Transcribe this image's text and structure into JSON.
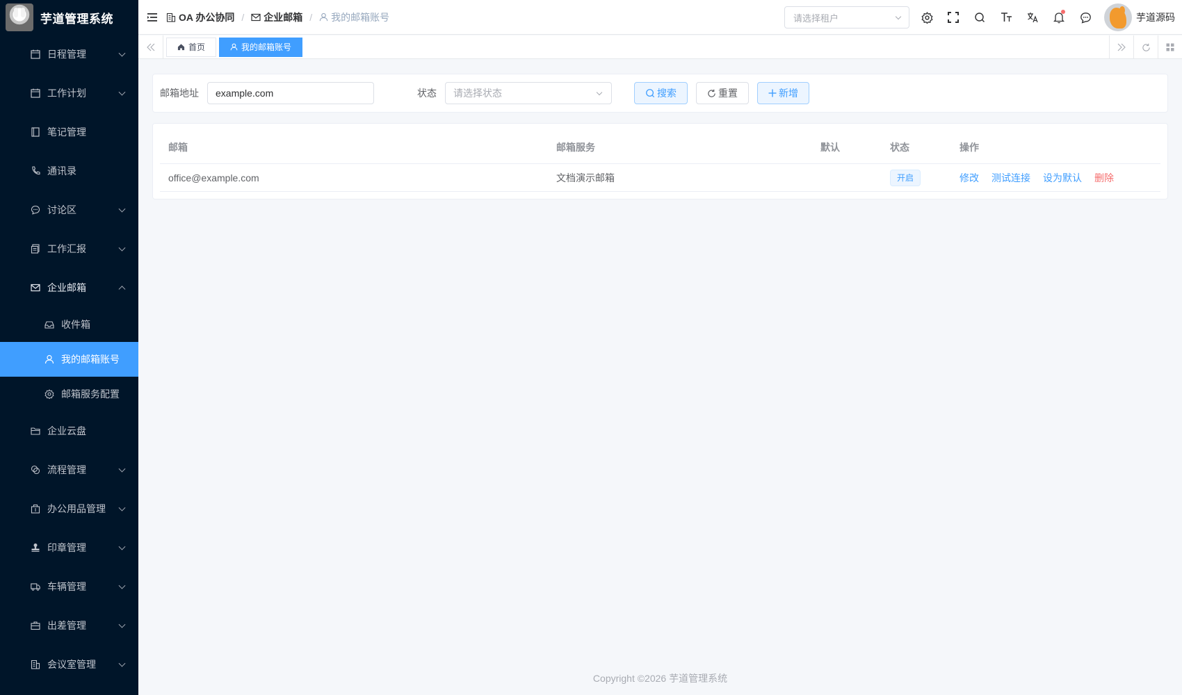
{
  "app": {
    "title": "芋道管理系统"
  },
  "sidebar": {
    "items": [
      {
        "label": "日程管理",
        "icon": "calendar-icon",
        "expandable": true
      },
      {
        "label": "工作计划",
        "icon": "calendar-icon",
        "expandable": true
      },
      {
        "label": "笔记管理",
        "icon": "notebook-icon",
        "expandable": false
      },
      {
        "label": "通讯录",
        "icon": "phone-icon",
        "expandable": false
      },
      {
        "label": "讨论区",
        "icon": "chat-icon",
        "expandable": true
      },
      {
        "label": "工作汇报",
        "icon": "report-icon",
        "expandable": true
      },
      {
        "label": "企业邮箱",
        "icon": "mail-icon",
        "expandable": true,
        "expanded": true
      },
      {
        "label": "收件箱",
        "icon": "inbox-icon",
        "sub": true
      },
      {
        "label": "我的邮箱账号",
        "icon": "user-icon",
        "sub": true,
        "active": true
      },
      {
        "label": "邮箱服务配置",
        "icon": "gear-icon",
        "sub": true
      },
      {
        "label": "企业云盘",
        "icon": "folder-icon",
        "expandable": false
      },
      {
        "label": "流程管理",
        "icon": "flow-icon",
        "expandable": true
      },
      {
        "label": "办公用品管理",
        "icon": "box-icon",
        "expandable": true
      },
      {
        "label": "印章管理",
        "icon": "stamp-icon",
        "expandable": true
      },
      {
        "label": "车辆管理",
        "icon": "truck-icon",
        "expandable": true
      },
      {
        "label": "出差管理",
        "icon": "briefcase-icon",
        "expandable": true
      },
      {
        "label": "会议室管理",
        "icon": "building-icon",
        "expandable": true
      }
    ]
  },
  "header": {
    "breadcrumb": [
      "OA 办公协同",
      "企业邮箱",
      "我的邮箱账号"
    ],
    "tenant_placeholder": "请选择租户",
    "user_name": "芋道源码"
  },
  "tags": {
    "items": [
      {
        "label": "首页",
        "icon": "home-icon",
        "active": false
      },
      {
        "label": "我的邮箱账号",
        "icon": "user-icon",
        "active": true
      }
    ]
  },
  "search": {
    "email_label": "邮箱地址",
    "email_value": "example.com",
    "status_label": "状态",
    "status_placeholder": "请选择状态",
    "search_button": "搜索",
    "reset_button": "重置",
    "add_button": "新增"
  },
  "table": {
    "columns": [
      "邮箱",
      "邮箱服务",
      "默认",
      "状态",
      "操作"
    ],
    "rows": [
      {
        "email": "office@example.com",
        "service": "文档演示邮箱",
        "default": "",
        "status": "开启",
        "actions": [
          "修改",
          "测试连接",
          "设为默认",
          "删除"
        ]
      }
    ]
  },
  "footer": {
    "copyright": "Copyright ©2026 芋道管理系统"
  },
  "colors": {
    "primary": "#409eff",
    "sidebar_bg": "#001529",
    "danger": "#f56c6c"
  }
}
